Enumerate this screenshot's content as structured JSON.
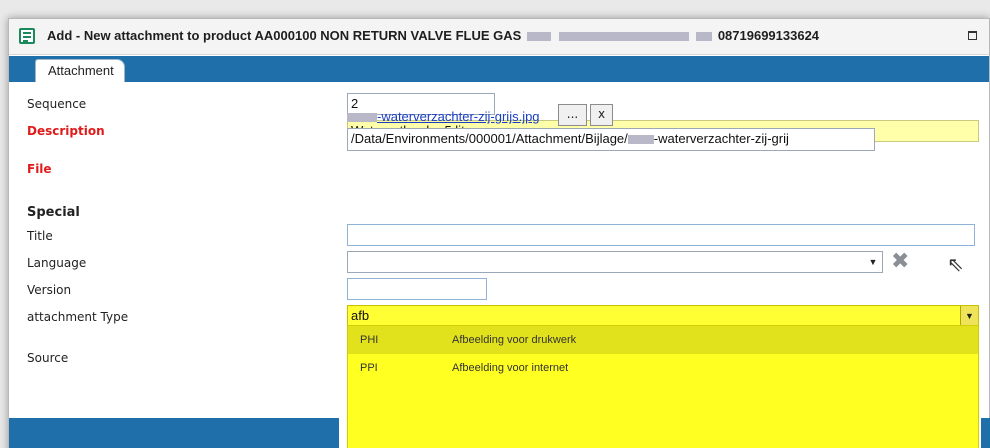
{
  "window": {
    "title": "Add - New attachment to product AA000100 NON RETURN VALVE FLUE GAS",
    "title_suffix": "08719699133624",
    "icon": "form-icon"
  },
  "tabs": [
    {
      "label": "Attachment"
    }
  ],
  "form": {
    "sequence": {
      "label": "Sequence",
      "value": "2"
    },
    "description": {
      "label": "Description",
      "value": "Waterontharder 5 liter"
    },
    "file": {
      "label": "File",
      "link_text": "-waterverzachter-zij-grijs.jpg",
      "browse_label": "...",
      "remove_label": "x",
      "path_prefix": "/Data/Environments/000001/Attachment/Bijlage/",
      "path_suffix": "-waterverzachter-zij-grij"
    },
    "special_heading": "Special",
    "title": {
      "label": "Title",
      "value": ""
    },
    "language": {
      "label": "Language",
      "value": ""
    },
    "version": {
      "label": "Version",
      "value": ""
    },
    "attachment_type": {
      "label": "attachment Type",
      "value": "afb",
      "options": [
        {
          "code": "PHI",
          "description": "Afbeelding voor drukwerk"
        },
        {
          "code": "PPI",
          "description": "Afbeelding voor internet"
        }
      ]
    },
    "source": {
      "label": "Source"
    }
  },
  "colors": {
    "accent": "#1f6fab",
    "required": "#e01b1b",
    "highlight": "#ffff22",
    "selected_row": "#e2e21c"
  }
}
